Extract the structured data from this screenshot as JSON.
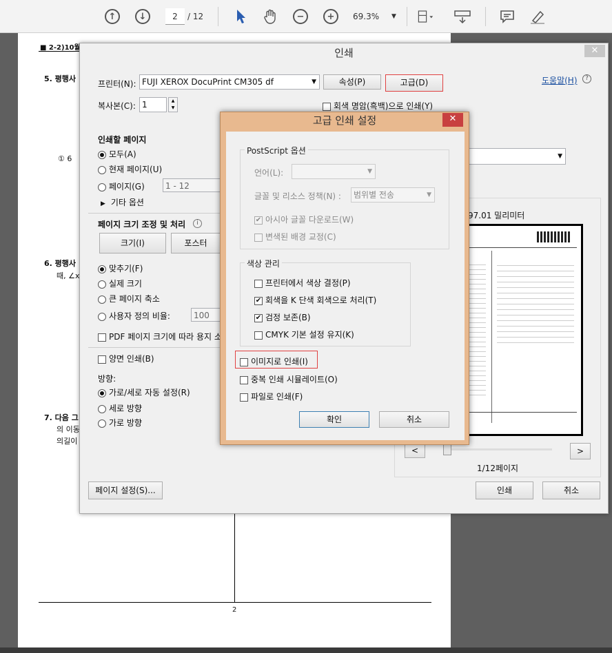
{
  "toolbar": {
    "current_page": "2",
    "page_total": "/ 12",
    "zoom": "69.3%"
  },
  "document": {
    "header_text": "■ 2-2)10월1주",
    "q5": "5.  평행사",
    "q5_choice": "① 6",
    "q6_line1": "6.  평행사",
    "q6_line2": "때, ∠x +",
    "q7_line1": "7.  다음 그",
    "q7_line2": "의 이동",
    "q7_line3": "의길이",
    "page_number": "2"
  },
  "print_dialog": {
    "title": "인쇄",
    "printer_label": "프린터(N):",
    "printer_value": "FUJI XEROX DocuPrint CM305 df",
    "properties_button": "속성(P)",
    "advanced_button": "고급(D)",
    "help_link": "도움말(H)",
    "copies_label": "복사본(C):",
    "copies_value": "1",
    "grayscale_label": "회색 명암(흑백)으로 인쇄(Y)",
    "pages_section": "인쇄할 페이지",
    "pages_all": "모두(A)",
    "pages_current": "현재 페이지(U)",
    "pages_range": "페이지(G)",
    "pages_range_value": "1 - 12",
    "more_options": "기타 옵션",
    "sizing_section": "페이지 크기 조정 및 처리",
    "size_button": "크기(I)",
    "poster_button": "포스터",
    "fit": "맞추기(F)",
    "actual_size": "실제 크기",
    "shrink": "큰 페이지 축소",
    "custom_scale": "사용자 정의 비율:",
    "custom_scale_value": "100",
    "pdf_page_size": "PDF 페이지 크기에 따라 용지 소",
    "duplex": "양면 인쇄(B)",
    "orientation_label": "방향:",
    "orient_auto": "가로/세로 자동 설정(R)",
    "orient_portrait": "세로 방향",
    "orient_landscape": "가로 방향",
    "preview_size": "97.01 밀리미터",
    "preview_page": "1/12페이지",
    "prev_button": "<",
    "next_button": ">",
    "page_setup_button": "페이지 설정(S)...",
    "print_button": "인쇄",
    "cancel_button": "취소",
    "close": "✕"
  },
  "advanced_dialog": {
    "title": "고급 인쇄 설정",
    "close": "✕",
    "postscript_group": "PostScript 옵션",
    "language_label": "언어(L):",
    "font_policy_label": "글꼴 및 리소스 정책(N) :",
    "font_policy_value": "범위별 전송",
    "download_asian_fonts": "아시아 글꼴 다운로드(W)",
    "correct_background": "변색된 배경 교정(C)",
    "color_group": "색상 관리",
    "printer_color": "프린터에서 색상 결정(P)",
    "gray_as_k": "회색을 K 단색 회색으로 처리(T)",
    "preserve_black": "검정 보존(B)",
    "keep_cmyk": "CMYK 기본 설정 유지(K)",
    "print_as_image": "이미지로 인쇄(I)",
    "simulate_overprint": "중복 인쇄 시뮬레이트(O)",
    "print_to_file": "파일로 인쇄(F)",
    "ok_button": "확인",
    "cancel_button": "취소"
  },
  "colors": {
    "accent_red": "#e04040",
    "adv_frame": "#e8b98f",
    "link_blue": "#1a4fa0"
  }
}
